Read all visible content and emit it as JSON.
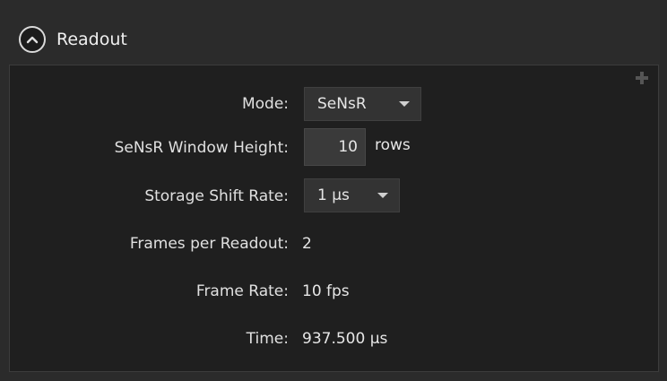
{
  "section": {
    "title": "Readout",
    "collapse_icon": "chevron-up-icon"
  },
  "rows": {
    "mode": {
      "label": "Mode:",
      "value": "SeNsR"
    },
    "window_height": {
      "label": "SeNsR Window Height:",
      "value": "10",
      "unit": "rows"
    },
    "shift_rate": {
      "label": "Storage Shift Rate:",
      "value": "1 µs"
    },
    "frames": {
      "label": "Frames per Readout:",
      "value": "2"
    },
    "frame_rate": {
      "label": "Frame Rate:",
      "value": "10 fps"
    },
    "time": {
      "label": "Time:",
      "value": "937.500 µs"
    }
  },
  "colors": {
    "background": "#2b2b2b",
    "panel": "#1f1f1f",
    "text": "#e6e6e6"
  }
}
